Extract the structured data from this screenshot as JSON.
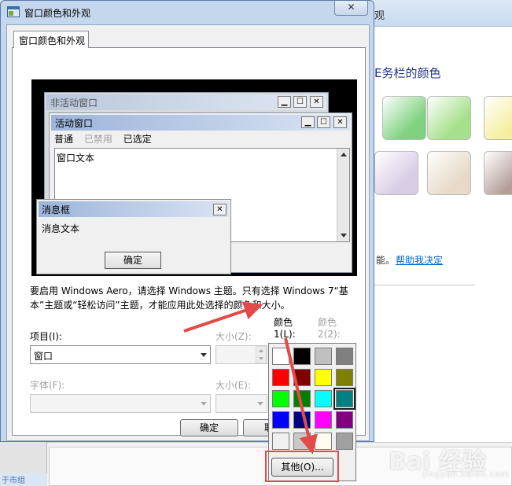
{
  "background_window": {
    "title_fragment": "观",
    "heading_fragment": "E务栏的颜色",
    "help_pre": "能。",
    "help_link": "帮助我决定",
    "taskbar_stub": "于市组",
    "swatch_colors": [
      "#7fd17f",
      "#a5e08a",
      "#f5ee9a",
      "#d9cde6",
      "#e7dac8",
      "#b59e9a"
    ]
  },
  "dialog": {
    "title": "窗口颜色和外观",
    "close_label": "✕",
    "tab_label": "窗口颜色和外观",
    "preview": {
      "inactive_title": "非活动窗口",
      "active_title": "活动窗口",
      "menu_items": [
        "普通",
        "已禁用",
        "已选定"
      ],
      "window_text": "窗口文本",
      "message_title": "消息框",
      "message_text": "消息文本",
      "message_ok": "确定"
    },
    "note": "要启用 Windows Aero，请选择 Windows 主题。只有选择 Windows 7“基本”主题或“轻松访问”主题，才能应用此处选择的颜色和大小。",
    "item_label": "项目(I):",
    "item_value": "窗口",
    "size_label": "大小(Z):",
    "color1_label_line1": "颜色",
    "color1_label_line2": "1(L):",
    "color2_label_line1": "颜色",
    "color2_label_line2": "2(2):",
    "font_label": "字体(F):",
    "font_size_label": "大小(E):",
    "ok_button": "确定",
    "cancel_button_partial": "取",
    "selected_color": "#ffffff"
  },
  "palette": {
    "colors": [
      "#ffffff",
      "#000000",
      "#c0c0c0",
      "#808080",
      "#ff0000",
      "#800000",
      "#ffff00",
      "#808000",
      "#00ff00",
      "#008000",
      "#00ffff",
      "#008080",
      "#0000ff",
      "#000080",
      "#ff00ff",
      "#800080",
      "#f0f0f0",
      "#c8c8c8",
      "#fffaf0",
      "#a0a0a0"
    ],
    "selected_index": 11,
    "other_button": "其他(O)..."
  },
  "annotation_color": "#e24a4a",
  "watermark": {
    "brand": "Bai 经验",
    "sub": "jingyan.baidu.com"
  }
}
